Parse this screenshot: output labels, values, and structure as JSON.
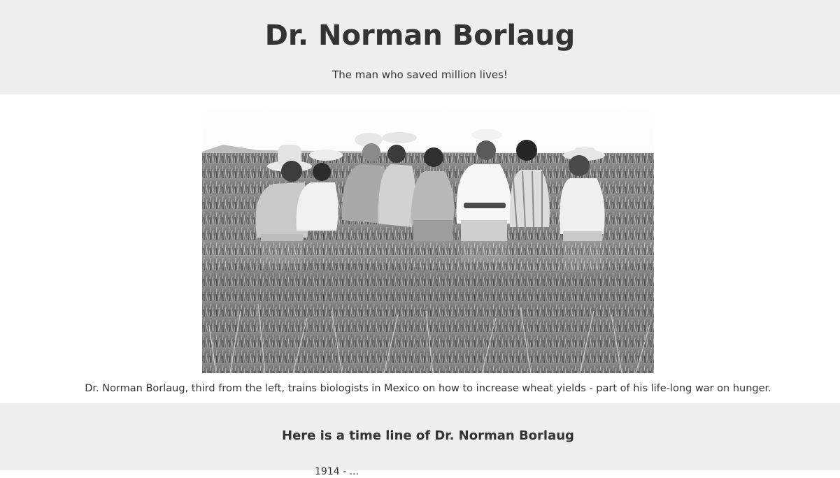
{
  "header": {
    "title": "Dr. Norman Borlaug",
    "tagline": "The man who saved million lives!"
  },
  "photo": {
    "alt": "Dr. Norman Borlaug and biologists standing in a wheat field",
    "style": "black-and-white photograph"
  },
  "caption": "Dr. Norman Borlaug, third from the left, trains biologists in Mexico on how to increase wheat yields - part of his life-long war on hunger.",
  "timeline": {
    "heading": "Here is a time line of Dr. Norman Borlaug",
    "first_item_partial": "1914 - ..."
  },
  "colors": {
    "band_background": "#eeeeee",
    "page_background": "#ffffff",
    "text": "#333333"
  }
}
